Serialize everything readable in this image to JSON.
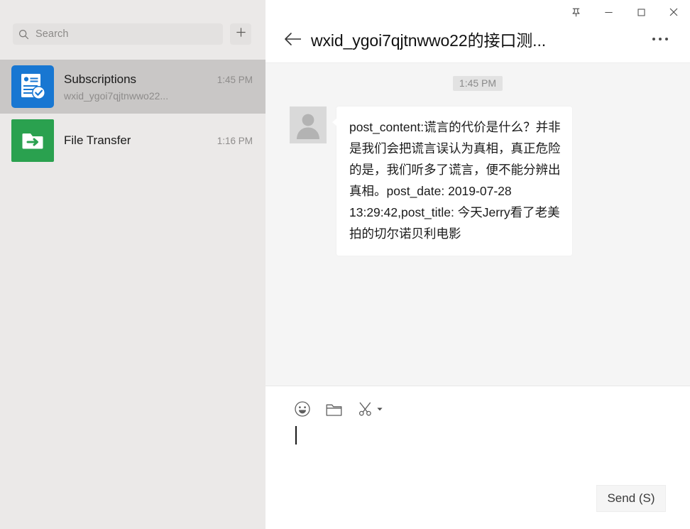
{
  "sidebar": {
    "search": {
      "placeholder": "Search",
      "icon": "search-icon",
      "value": ""
    },
    "add_button": {
      "label": "+",
      "icon": "plus-icon"
    },
    "conversations": [
      {
        "name": "Subscriptions",
        "time": "1:45 PM",
        "preview": "wxid_ygoi7qjtnwwo22...",
        "icon": "subscriptions-icon",
        "icon_color": "#1877d2",
        "selected": true
      },
      {
        "name": "File Transfer",
        "time": "1:16 PM",
        "preview": "",
        "icon": "file-transfer-icon",
        "icon_color": "#2aa14f",
        "selected": false
      }
    ]
  },
  "titlebar": {
    "pin_label": "pin-icon",
    "minimize_label": "minimize-icon",
    "maximize_label": "maximize-icon",
    "close_label": "close-icon"
  },
  "chat": {
    "back_icon": "arrow-left-icon",
    "title": "wxid_ygoi7qjtnwwo22的接口测...",
    "more_icon": "more-horizontal-icon",
    "daystamp": "1:45 PM",
    "messages": [
      {
        "avatar": "default-user-avatar",
        "text": "post_content:谎言的代价是什么？并非是我们会把谎言误认为真相，真正危险的是，我们听多了谎言，便不能分辨出真相。post_date: 2019-07-28 13:29:42,post_title: 今天Jerry看了老美拍的切尔诺贝利电影"
      }
    ]
  },
  "composer": {
    "tools": [
      {
        "name": "emoji-icon",
        "label": "Emoji"
      },
      {
        "name": "folder-icon",
        "label": "File"
      },
      {
        "name": "scissors-icon",
        "label": "Screenshot"
      }
    ],
    "input_value": "",
    "send_label": "Send (S)"
  },
  "colors": {
    "sidebar_bg": "#ebe9e8",
    "selected_row": "#c9c7c6",
    "chat_bg": "#f5f5f5",
    "bubble_bg": "#ffffff",
    "accent_blue": "#1877d2",
    "accent_green": "#2aa14f"
  }
}
